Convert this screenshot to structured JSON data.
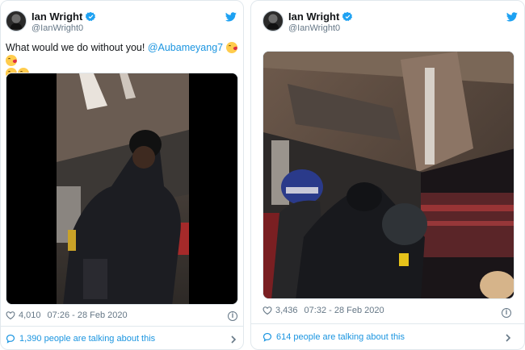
{
  "colors": {
    "link": "#1b95e0",
    "verified": "#1da1f2",
    "muted": "#657786",
    "text": "#14171a"
  },
  "tweets": [
    {
      "author": {
        "name": "Ian Wright",
        "handle": "@IanWright0"
      },
      "text_prefix": "What would we do without you!",
      "mention": "@Aubameyang7",
      "likes": "4,010",
      "timestamp": "07:26 - 28 Feb 2020",
      "talking": "1,390 people are talking about this"
    },
    {
      "author": {
        "name": "Ian Wright",
        "handle": "@IanWright0"
      },
      "likes": "3,436",
      "timestamp": "07:32 - 28 Feb 2020",
      "talking": "614 people are talking about this"
    }
  ],
  "icons": [
    "verified-badge-icon",
    "twitter-bird-icon",
    "heart-icon",
    "info-icon",
    "comment-bubble-icon",
    "chevron-right-icon"
  ]
}
